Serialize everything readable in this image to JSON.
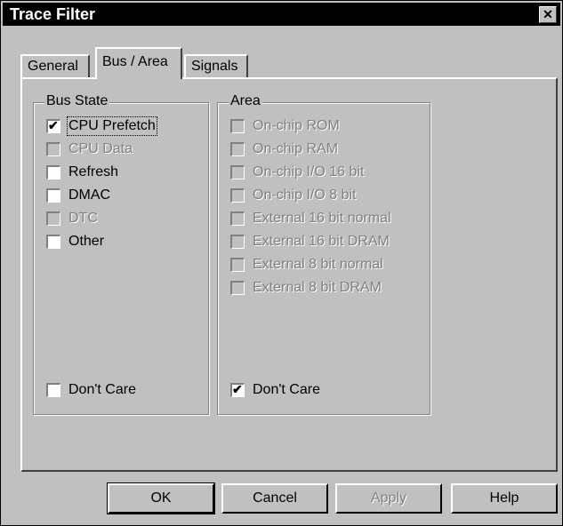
{
  "window": {
    "title": "Trace Filter",
    "close": "✕"
  },
  "tabs": [
    {
      "label": "General"
    },
    {
      "label": "Bus / Area"
    },
    {
      "label": "Signals"
    }
  ],
  "bus_state": {
    "title": "Bus State",
    "items": [
      {
        "label": "CPU Prefetch",
        "checked": true,
        "disabled": false
      },
      {
        "label": "CPU Data",
        "checked": false,
        "disabled": true
      },
      {
        "label": "Refresh",
        "checked": false,
        "disabled": false
      },
      {
        "label": "DMAC",
        "checked": false,
        "disabled": false
      },
      {
        "label": "DTC",
        "checked": false,
        "disabled": true
      },
      {
        "label": "Other",
        "checked": false,
        "disabled": false
      }
    ],
    "dont_care": {
      "label": "Don't Care",
      "checked": false
    }
  },
  "area": {
    "title": "Area",
    "items": [
      {
        "label": "On-chip ROM",
        "checked": false,
        "disabled": true
      },
      {
        "label": "On-chip RAM",
        "checked": false,
        "disabled": true
      },
      {
        "label": "On-chip I/O 16 bit",
        "checked": false,
        "disabled": true
      },
      {
        "label": "On-chip I/O 8 bit",
        "checked": false,
        "disabled": true
      },
      {
        "label": "External 16 bit normal",
        "checked": false,
        "disabled": true
      },
      {
        "label": "External 16 bit DRAM",
        "checked": false,
        "disabled": true
      },
      {
        "label": "External 8 bit normal",
        "checked": false,
        "disabled": true
      },
      {
        "label": "External 8 bit DRAM",
        "checked": false,
        "disabled": true
      }
    ],
    "dont_care": {
      "label": "Don't Care",
      "checked": true
    }
  },
  "buttons": {
    "ok": "OK",
    "cancel": "Cancel",
    "apply": "Apply",
    "help": "Help"
  },
  "check_glyph": "✔"
}
